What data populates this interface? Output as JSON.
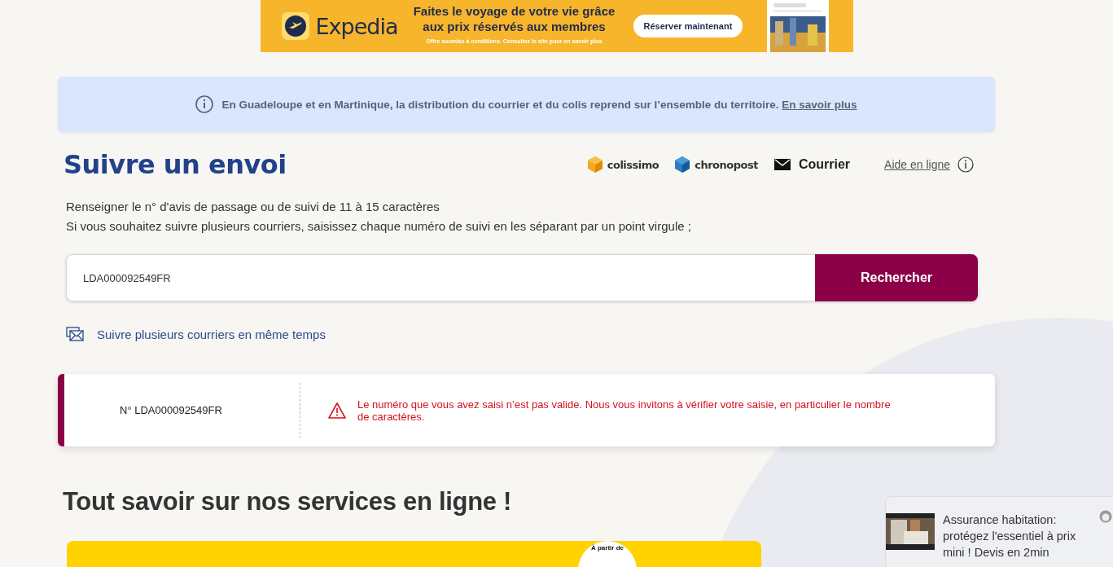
{
  "ad_banner": {
    "brand": "Expedia",
    "headline": "Faites le voyage de votre vie grâce aux prix réservés aux membres",
    "button": "Réserver maintenant",
    "fine_print": "Offre soumise à conditions. Consultez le site pour en savoir plus"
  },
  "notice": {
    "text": "En Guadeloupe et en Martinique, la distribution du courrier et du colis reprend sur l’ensemble du territoire.",
    "link": "En savoir plus"
  },
  "title": "Suivre un envoi",
  "brands": [
    {
      "kind": "colissimo",
      "label": "colissimo"
    },
    {
      "kind": "chronopost",
      "label": "chronopost"
    },
    {
      "kind": "courrier",
      "label": "Courrier"
    }
  ],
  "help_link": "Aide en ligne",
  "instructions": [
    "Renseigner le n° d'avis de passage ou de suivi de 11 à 15 caractères",
    "Si vous souhaitez suivre plusieurs courriers, saisissez chaque numéro de suivi en les séparant par un point virgule ;"
  ],
  "search": {
    "value": "LDA000092549FR",
    "button": "Rechercher"
  },
  "multi_link": "Suivre plusieurs courriers en même temps",
  "result": {
    "number": "N° LDA000092549FR",
    "error": "Le numéro que vous avez saisi n’est pas valide. Nous vous invitons à vérifier votre saisie, en particulier le nombre de caractères."
  },
  "services_title": "Tout savoir sur nos services en ligne !",
  "promo": {
    "badge": "À partir de"
  },
  "popup": {
    "text": "Assurance habitation: protégez l'essentiel à prix mini ! Devis en 2min"
  }
}
